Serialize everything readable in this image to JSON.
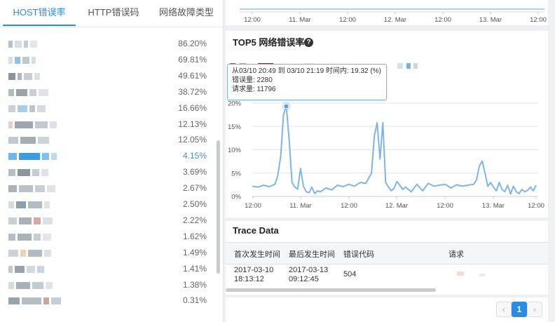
{
  "tabs": [
    {
      "label": "HOST错误率",
      "active": true
    },
    {
      "label": "HTTP错误码",
      "active": false
    },
    {
      "label": "网络故障类型",
      "active": false
    }
  ],
  "hosts": [
    {
      "pct": "86.20%"
    },
    {
      "pct": "69.81%"
    },
    {
      "pct": "49.61%"
    },
    {
      "pct": "38.72%"
    },
    {
      "pct": "16.66%"
    },
    {
      "pct": "12.13%"
    },
    {
      "pct": "12.05%"
    },
    {
      "pct": "4.15%",
      "highlight": true
    },
    {
      "pct": "3.69%"
    },
    {
      "pct": "2.67%"
    },
    {
      "pct": "2.50%"
    },
    {
      "pct": "2.22%"
    },
    {
      "pct": "1.62%"
    },
    {
      "pct": "1.49%"
    },
    {
      "pct": "1.41%"
    },
    {
      "pct": "1.38%"
    },
    {
      "pct": "0.31%"
    }
  ],
  "top_chart": {
    "x_ticks": [
      "12:00",
      "11. Mar",
      "12:00",
      "12. Mar",
      "12:00",
      "13. Mar",
      "12:00"
    ]
  },
  "top5": {
    "title": "TOP5 网络错误率",
    "help_icon": "?",
    "tooltip": {
      "line1": "从03/10 20:49 到 03/10 21:19 时间内: 19.32 (%)",
      "line2": "错误量: 2280",
      "line3": "请求量: 11796"
    }
  },
  "chart_data": {
    "type": "line",
    "y_ticks": [
      "20%",
      "15%",
      "10%",
      "5%",
      "0%"
    ],
    "ylim": [
      0,
      20
    ],
    "x_ticks": [
      "12:00",
      "11. Mar",
      "12:00",
      "12. Mar",
      "12:00",
      "13. Mar",
      "12:00"
    ],
    "series": [
      {
        "color": "#7cb5ec",
        "x": [
          0.0,
          0.02,
          0.04,
          0.06,
          0.08,
          0.09,
          0.1,
          0.11,
          0.12,
          0.13,
          0.14,
          0.15,
          0.16,
          0.17,
          0.18,
          0.19,
          0.2,
          0.21,
          0.22,
          0.23,
          0.24,
          0.26,
          0.28,
          0.3,
          0.32,
          0.34,
          0.36,
          0.38,
          0.4,
          0.42,
          0.43,
          0.44,
          0.45,
          0.46,
          0.47,
          0.48,
          0.49,
          0.5,
          0.51,
          0.52,
          0.53,
          0.54,
          0.56,
          0.58,
          0.6,
          0.62,
          0.64,
          0.66,
          0.68,
          0.7,
          0.72,
          0.74,
          0.76,
          0.78,
          0.79,
          0.8,
          0.81,
          0.82,
          0.83,
          0.84,
          0.85,
          0.86,
          0.87,
          0.88,
          0.89,
          0.9,
          0.91,
          0.92,
          0.93,
          0.94,
          0.95,
          0.96,
          0.97,
          0.98,
          0.99,
          1.0
        ],
        "y": [
          2.2,
          2.0,
          2.4,
          2.1,
          2.6,
          4.5,
          8.5,
          17.5,
          19.3,
          12.0,
          3.0,
          2.0,
          1.6,
          6.0,
          2.2,
          1.0,
          0.8,
          2.0,
          0.6,
          1.2,
          1.0,
          1.8,
          1.4,
          2.4,
          2.1,
          2.6,
          2.2,
          3.0,
          2.8,
          5.0,
          13.0,
          15.8,
          8.0,
          15.8,
          3.0,
          2.0,
          1.2,
          1.8,
          3.2,
          2.4,
          1.5,
          2.0,
          1.0,
          2.6,
          1.2,
          2.8,
          2.2,
          2.4,
          2.6,
          1.8,
          2.5,
          2.2,
          2.4,
          2.6,
          3.5,
          6.5,
          7.6,
          5.0,
          2.2,
          3.0,
          2.0,
          1.2,
          3.0,
          1.5,
          1.0,
          2.4,
          0.5,
          2.2,
          1.0,
          0.6,
          1.5,
          1.0,
          1.3,
          2.0,
          1.2,
          2.4
        ]
      }
    ]
  },
  "trace": {
    "title": "Trace Data",
    "columns": [
      "首次发生时间",
      "最后发生时间",
      "错误代码",
      "请求"
    ],
    "row": {
      "first_date": "2017-03-10",
      "first_time": "18:13:12",
      "last_date": "2017-03-13",
      "last_time": "09:12:45",
      "code": "504"
    }
  },
  "pagination": {
    "prev": "‹",
    "current": "1",
    "next": "›"
  }
}
